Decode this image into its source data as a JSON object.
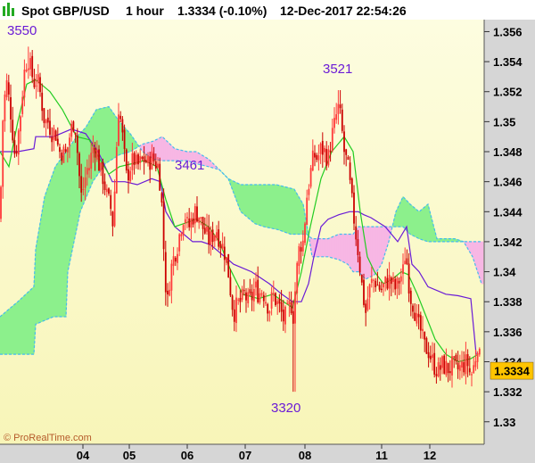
{
  "header": {
    "symbol": "Spot GBP/USD",
    "timeframe": "1 hour",
    "price_change": "1.3334 (-0.10%)",
    "datetime": "12-Dec-2017 22:54:26",
    "icon_name": "chart-bars-icon"
  },
  "footer": {
    "copyright": "© ProRealTime.com"
  },
  "colors": {
    "background_top": "#fdfde0",
    "background_bottom": "#f8f5b8",
    "axis_bg": "#d6d6d6",
    "candle_up": "#ff3a3a",
    "candle_down": "#cc0000",
    "tenkan": "#6a1bd6",
    "kijun": "#22cc22",
    "cloud_bull": "#8cf08c",
    "cloud_bear": "#f7b7e4",
    "span_line": "#44bbee",
    "price_tag": "#ffc400",
    "annotation": "#6a1bd6"
  },
  "chart_data": {
    "type": "candlestick",
    "instrument": "Spot GBP/USD",
    "interval": "1 hour",
    "last_price": 1.3334,
    "last_price_label": "1.3334",
    "ylim": [
      1.3285,
      1.3568
    ],
    "y_ticks": [
      1.356,
      1.354,
      1.352,
      1.35,
      1.348,
      1.346,
      1.344,
      1.342,
      1.34,
      1.338,
      1.336,
      1.334,
      1.332,
      1.33
    ],
    "y_tick_labels": [
      "1.356",
      "1.354",
      "1.352",
      "1.35",
      "1.348",
      "1.346",
      "1.344",
      "1.342",
      "1.34",
      "1.338",
      "1.336",
      "1.334",
      "1.332",
      "1.33"
    ],
    "x_tick_labels": [
      "04",
      "05",
      "06",
      "07",
      "08",
      "11",
      "12"
    ],
    "grid": false,
    "annotations": [
      "3550",
      "3521",
      "3461",
      "3320"
    ],
    "price_path": [
      [
        0,
        1.3435
      ],
      [
        3,
        1.35
      ],
      [
        7,
        1.3528
      ],
      [
        12,
        1.3506
      ],
      [
        17,
        1.3476
      ],
      [
        22,
        1.3499
      ],
      [
        27,
        1.3532
      ],
      [
        31,
        1.3544
      ],
      [
        34,
        1.3536
      ],
      [
        38,
        1.3526
      ],
      [
        42,
        1.3528
      ],
      [
        46,
        1.3516
      ],
      [
        50,
        1.35
      ],
      [
        54,
        1.35
      ],
      [
        58,
        1.3493
      ],
      [
        62,
        1.3494
      ],
      [
        66,
        1.348
      ],
      [
        70,
        1.348
      ],
      [
        74,
        1.3478
      ],
      [
        78,
        1.349
      ],
      [
        82,
        1.35
      ],
      [
        85,
        1.3495
      ],
      [
        88,
        1.347
      ],
      [
        91,
        1.345
      ],
      [
        94,
        1.3457
      ],
      [
        97,
        1.3468
      ],
      [
        100,
        1.347
      ],
      [
        104,
        1.3483
      ],
      [
        108,
        1.3482
      ],
      [
        112,
        1.3468
      ],
      [
        116,
        1.3462
      ],
      [
        120,
        1.345
      ],
      [
        124,
        1.3443
      ],
      [
        127,
        1.343
      ],
      [
        130,
        1.3475
      ],
      [
        133,
        1.351
      ],
      [
        136,
        1.3498
      ],
      [
        139,
        1.348
      ],
      [
        142,
        1.3462
      ],
      [
        146,
        1.347
      ],
      [
        150,
        1.3475
      ],
      [
        154,
        1.347
      ],
      [
        158,
        1.3473
      ],
      [
        162,
        1.3475
      ],
      [
        166,
        1.3472
      ],
      [
        170,
        1.3476
      ],
      [
        174,
        1.3473
      ],
      [
        178,
        1.347
      ],
      [
        182,
        1.344
      ],
      [
        185,
        1.3395
      ],
      [
        188,
        1.338
      ],
      [
        191,
        1.34
      ],
      [
        195,
        1.341
      ],
      [
        199,
        1.3418
      ],
      [
        203,
        1.343
      ],
      [
        207,
        1.344
      ],
      [
        211,
        1.3428
      ],
      [
        215,
        1.3435
      ],
      [
        219,
        1.344
      ],
      [
        223,
        1.3438
      ],
      [
        227,
        1.343
      ],
      [
        231,
        1.3425
      ],
      [
        235,
        1.342
      ],
      [
        239,
        1.3425
      ],
      [
        243,
        1.3428
      ],
      [
        247,
        1.342
      ],
      [
        251,
        1.3415
      ],
      [
        255,
        1.3405
      ],
      [
        259,
        1.3385
      ],
      [
        262,
        1.3372
      ],
      [
        266,
        1.3378
      ],
      [
        270,
        1.338
      ],
      [
        274,
        1.3385
      ],
      [
        278,
        1.338
      ],
      [
        282,
        1.3382
      ],
      [
        286,
        1.339
      ],
      [
        290,
        1.3385
      ],
      [
        294,
        1.3388
      ],
      [
        298,
        1.3382
      ],
      [
        302,
        1.3375
      ],
      [
        306,
        1.3385
      ],
      [
        310,
        1.338
      ],
      [
        314,
        1.3375
      ],
      [
        318,
        1.3368
      ],
      [
        322,
        1.3372
      ],
      [
        326,
        1.338
      ],
      [
        329,
        1.337
      ],
      [
        332,
        1.3396
      ],
      [
        336,
        1.3418
      ],
      [
        340,
        1.342
      ],
      [
        344,
        1.345
      ],
      [
        348,
        1.3465
      ],
      [
        352,
        1.3478
      ],
      [
        356,
        1.3475
      ],
      [
        360,
        1.3482
      ],
      [
        364,
        1.348
      ],
      [
        368,
        1.3475
      ],
      [
        372,
        1.349
      ],
      [
        376,
        1.35
      ],
      [
        379,
        1.351
      ],
      [
        382,
        1.3502
      ],
      [
        386,
        1.348
      ],
      [
        390,
        1.347
      ],
      [
        394,
        1.345
      ],
      [
        398,
        1.343
      ],
      [
        402,
        1.3412
      ],
      [
        406,
        1.339
      ],
      [
        410,
        1.3372
      ],
      [
        413,
        1.3385
      ],
      [
        416,
        1.3392
      ],
      [
        420,
        1.3395
      ],
      [
        424,
        1.339
      ],
      [
        428,
        1.3388
      ],
      [
        432,
        1.3392
      ],
      [
        436,
        1.3395
      ],
      [
        440,
        1.3392
      ],
      [
        444,
        1.3388
      ],
      [
        448,
        1.3395
      ],
      [
        452,
        1.34
      ],
      [
        455,
        1.3415
      ],
      [
        458,
        1.3395
      ],
      [
        461,
        1.3382
      ],
      [
        464,
        1.3378
      ],
      [
        468,
        1.3365
      ],
      [
        472,
        1.336
      ],
      [
        476,
        1.335
      ],
      [
        480,
        1.3348
      ],
      [
        484,
        1.3342
      ],
      [
        488,
        1.3336
      ],
      [
        492,
        1.3334
      ],
      [
        496,
        1.3338
      ],
      [
        500,
        1.3336
      ],
      [
        504,
        1.3335
      ],
      [
        508,
        1.3338
      ],
      [
        512,
        1.3334
      ],
      [
        516,
        1.3336
      ],
      [
        520,
        1.3338
      ],
      [
        524,
        1.334
      ],
      [
        528,
        1.333
      ],
      [
        532,
        1.3338
      ],
      [
        536,
        1.3354
      ],
      [
        539,
        1.3334
      ]
    ],
    "extremes": [
      {
        "x": 32,
        "value": 1.355,
        "label": "3550"
      },
      {
        "x": 380,
        "value": 1.3521,
        "label": "3521"
      },
      {
        "x": 330,
        "value": 1.332,
        "label": "3320"
      }
    ],
    "tenkan_sen": [
      [
        0,
        1.348
      ],
      [
        20,
        1.348
      ],
      [
        38,
        1.3482
      ],
      [
        40,
        1.349
      ],
      [
        60,
        1.349
      ],
      [
        80,
        1.3495
      ],
      [
        96,
        1.3492
      ],
      [
        110,
        1.348
      ],
      [
        126,
        1.346
      ],
      [
        140,
        1.346
      ],
      [
        154,
        1.3458
      ],
      [
        170,
        1.3462
      ],
      [
        180,
        1.346
      ],
      [
        186,
        1.344
      ],
      [
        196,
        1.343
      ],
      [
        206,
        1.3425
      ],
      [
        216,
        1.342
      ],
      [
        226,
        1.342
      ],
      [
        236,
        1.3418
      ],
      [
        248,
        1.3412
      ],
      [
        262,
        1.3405
      ],
      [
        282,
        1.34
      ],
      [
        302,
        1.3392
      ],
      [
        316,
        1.3385
      ],
      [
        328,
        1.338
      ],
      [
        338,
        1.338
      ],
      [
        346,
        1.3392
      ],
      [
        352,
        1.341
      ],
      [
        360,
        1.343
      ],
      [
        368,
        1.3435
      ],
      [
        380,
        1.3438
      ],
      [
        392,
        1.344
      ],
      [
        402,
        1.344
      ],
      [
        408,
        1.3438
      ],
      [
        416,
        1.3436
      ],
      [
        432,
        1.343
      ],
      [
        446,
        1.342
      ],
      [
        456,
        1.343
      ],
      [
        462,
        1.3405
      ],
      [
        470,
        1.34
      ],
      [
        480,
        1.339
      ],
      [
        500,
        1.3385
      ],
      [
        514,
        1.3384
      ],
      [
        528,
        1.3382
      ],
      [
        534,
        1.3345
      ]
    ],
    "kijun_sen": [
      [
        0,
        1.348
      ],
      [
        10,
        1.347
      ],
      [
        20,
        1.35
      ],
      [
        30,
        1.3525
      ],
      [
        40,
        1.3528
      ],
      [
        56,
        1.352
      ],
      [
        70,
        1.3508
      ],
      [
        86,
        1.349
      ],
      [
        100,
        1.3488
      ],
      [
        112,
        1.3475
      ],
      [
        122,
        1.3465
      ],
      [
        134,
        1.347
      ],
      [
        148,
        1.3472
      ],
      [
        162,
        1.3474
      ],
      [
        176,
        1.347
      ],
      [
        186,
        1.3448
      ],
      [
        196,
        1.343
      ],
      [
        206,
        1.3432
      ],
      [
        220,
        1.3435
      ],
      [
        234,
        1.343
      ],
      [
        246,
        1.342
      ],
      [
        258,
        1.3402
      ],
      [
        272,
        1.3385
      ],
      [
        290,
        1.3382
      ],
      [
        306,
        1.3385
      ],
      [
        318,
        1.338
      ],
      [
        328,
        1.3376
      ],
      [
        338,
        1.34
      ],
      [
        348,
        1.343
      ],
      [
        360,
        1.3462
      ],
      [
        372,
        1.348
      ],
      [
        386,
        1.349
      ],
      [
        396,
        1.348
      ],
      [
        404,
        1.344
      ],
      [
        412,
        1.341
      ],
      [
        420,
        1.34
      ],
      [
        430,
        1.3392
      ],
      [
        440,
        1.3395
      ],
      [
        450,
        1.34
      ],
      [
        458,
        1.3398
      ],
      [
        468,
        1.3385
      ],
      [
        478,
        1.337
      ],
      [
        488,
        1.3355
      ],
      [
        500,
        1.3345
      ],
      [
        514,
        1.334
      ],
      [
        528,
        1.3342
      ],
      [
        536,
        1.3345
      ]
    ],
    "cloud_span_a": [
      [
        0,
        1.337
      ],
      [
        20,
        1.338
      ],
      [
        38,
        1.339
      ],
      [
        40,
        1.3415
      ],
      [
        50,
        1.345
      ],
      [
        62,
        1.347
      ],
      [
        74,
        1.348
      ],
      [
        86,
        1.349
      ],
      [
        96,
        1.3496
      ],
      [
        108,
        1.3508
      ],
      [
        122,
        1.351
      ],
      [
        134,
        1.35
      ],
      [
        146,
        1.3492
      ],
      [
        160,
        1.348
      ],
      [
        172,
        1.3475
      ],
      [
        182,
        1.3474
      ],
      [
        196,
        1.3474
      ],
      [
        210,
        1.3474
      ],
      [
        220,
        1.3472
      ],
      [
        234,
        1.347
      ],
      [
        246,
        1.3468
      ],
      [
        256,
        1.3462
      ],
      [
        270,
        1.3458
      ],
      [
        290,
        1.3458
      ],
      [
        310,
        1.3458
      ],
      [
        330,
        1.3455
      ],
      [
        340,
        1.3445
      ],
      [
        346,
        1.3425
      ],
      [
        350,
        1.341
      ],
      [
        358,
        1.341
      ],
      [
        368,
        1.341
      ],
      [
        380,
        1.3408
      ],
      [
        390,
        1.3405
      ],
      [
        396,
        1.34
      ],
      [
        402,
        1.34
      ],
      [
        410,
        1.3395
      ],
      [
        420,
        1.3398
      ],
      [
        428,
        1.3405
      ],
      [
        436,
        1.342
      ],
      [
        444,
        1.344
      ],
      [
        452,
        1.345
      ],
      [
        460,
        1.3445
      ],
      [
        470,
        1.344
      ],
      [
        480,
        1.3445
      ],
      [
        490,
        1.3422
      ],
      [
        500,
        1.3422
      ],
      [
        510,
        1.3422
      ],
      [
        520,
        1.342
      ],
      [
        530,
        1.341
      ],
      [
        540,
        1.3392
      ]
    ],
    "cloud_span_b": [
      [
        0,
        1.3345
      ],
      [
        20,
        1.3345
      ],
      [
        38,
        1.3345
      ],
      [
        40,
        1.3365
      ],
      [
        60,
        1.337
      ],
      [
        74,
        1.337
      ],
      [
        76,
        1.34
      ],
      [
        90,
        1.344
      ],
      [
        104,
        1.346
      ],
      [
        118,
        1.3472
      ],
      [
        134,
        1.3478
      ],
      [
        146,
        1.348
      ],
      [
        160,
        1.3485
      ],
      [
        172,
        1.3487
      ],
      [
        182,
        1.349
      ],
      [
        196,
        1.3482
      ],
      [
        210,
        1.348
      ],
      [
        220,
        1.348
      ],
      [
        234,
        1.3475
      ],
      [
        246,
        1.3468
      ],
      [
        256,
        1.3462
      ],
      [
        270,
        1.344
      ],
      [
        286,
        1.3432
      ],
      [
        296,
        1.343
      ],
      [
        312,
        1.3428
      ],
      [
        326,
        1.3425
      ],
      [
        340,
        1.3425
      ],
      [
        344,
        1.3425
      ],
      [
        350,
        1.3422
      ],
      [
        358,
        1.3422
      ],
      [
        368,
        1.3422
      ],
      [
        380,
        1.3425
      ],
      [
        390,
        1.3425
      ],
      [
        396,
        1.3425
      ],
      [
        402,
        1.343
      ],
      [
        410,
        1.343
      ],
      [
        420,
        1.343
      ],
      [
        428,
        1.343
      ],
      [
        436,
        1.343
      ],
      [
        444,
        1.343
      ],
      [
        452,
        1.343
      ],
      [
        460,
        1.3425
      ],
      [
        470,
        1.3422
      ],
      [
        480,
        1.342
      ],
      [
        490,
        1.342
      ],
      [
        500,
        1.342
      ],
      [
        510,
        1.342
      ],
      [
        520,
        1.342
      ],
      [
        530,
        1.342
      ],
      [
        540,
        1.342
      ]
    ]
  }
}
